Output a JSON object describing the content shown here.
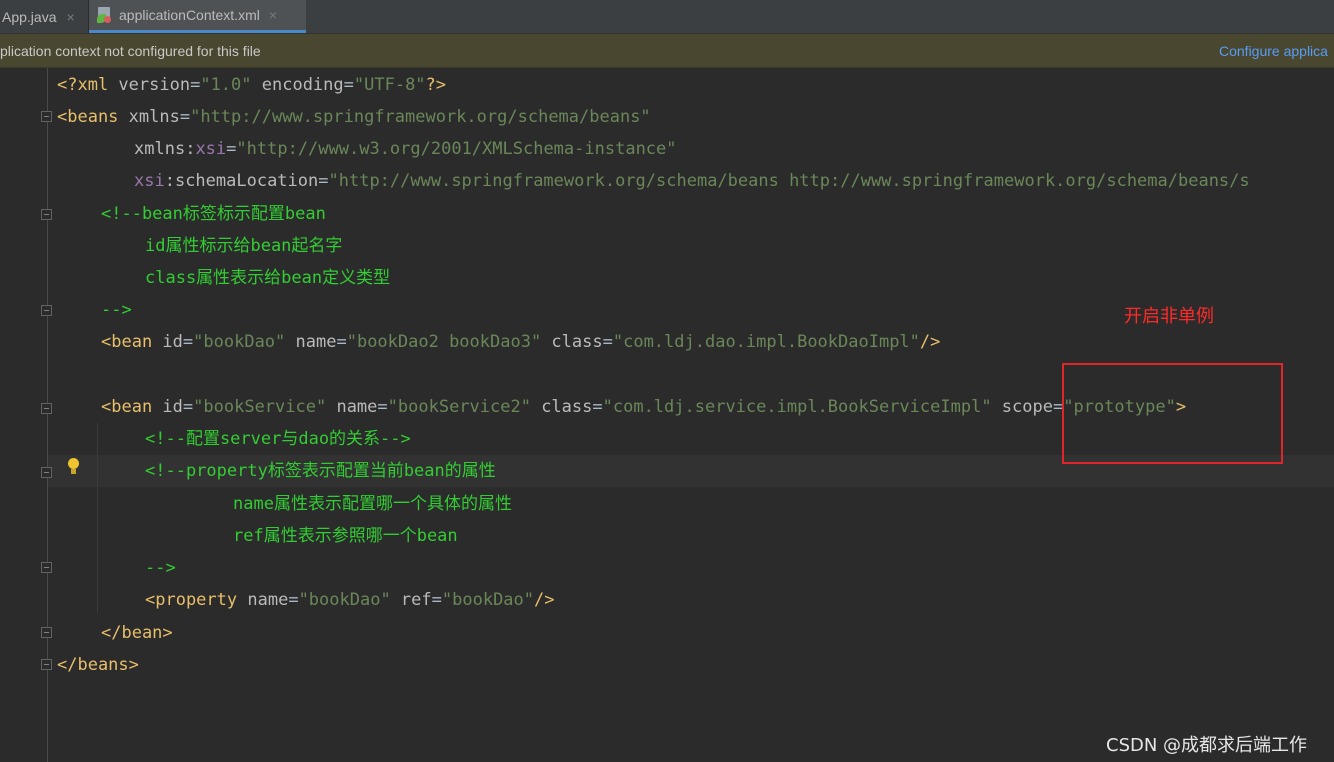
{
  "tabs": [
    {
      "label": "App.java",
      "close": "×"
    },
    {
      "label": "applicationContext.xml",
      "close": "×",
      "active": true
    }
  ],
  "banner": {
    "message": "plication context not configured for this file",
    "action": "Configure applica"
  },
  "code": {
    "l1": {
      "a": "<?xml ",
      "b": "version",
      "c": "=",
      "d": "\"1.0\"",
      "e": " encoding",
      "f": "=",
      "g": "\"UTF-8\"",
      "h": "?>"
    },
    "l2": {
      "a": "<beans ",
      "b": "xmlns",
      "c": "=",
      "d": "\"http://www.springframework.org/schema/beans\""
    },
    "l3": {
      "a": "xmlns",
      "b": ":",
      "c": "xsi",
      "d": "=",
      "e": "\"http://www.w3.org/2001/XMLSchema-instance\""
    },
    "l4": {
      "a": "xsi",
      "b": ":schemaLocation",
      "c": "=",
      "d": "\"http://www.springframework.org/schema/beans http://www.springframework.org/schema/beans/s"
    },
    "l5": "<!--bean标签标示配置bean",
    "l6": "id属性标示给bean起名字",
    "l7": "class属性表示给bean定义类型",
    "l8": "-->",
    "l9": {
      "a": "<bean ",
      "b": "id",
      "c": "=",
      "d": "\"bookDao\"",
      "e": " name",
      "f": "=",
      "g": "\"bookDao2 bookDao3\"",
      "h": " class",
      "i": "=",
      "j": "\"com.ldj.dao.impl.BookDaoImpl\"",
      "k": "/>"
    },
    "l11": {
      "a": "<bean ",
      "b": "id",
      "c": "=",
      "d": "\"bookService\"",
      "e": " name",
      "f": "=",
      "g": "\"bookService2\"",
      "h": " class",
      "i": "=",
      "j": "\"com.ldj.service.impl.BookServiceImpl\"",
      "k": " scope",
      "l": "=",
      "m": "\"prototype\"",
      "n": ">"
    },
    "l12": "<!--配置server与dao的关系-->",
    "l13": "<!--property标签表示配置当前bean的属性",
    "l14": "name属性表示配置哪一个具体的属性",
    "l15": "ref属性表示参照哪一个bean",
    "l16": "-->",
    "l17": {
      "a": "<property ",
      "b": "name",
      "c": "=",
      "d": "\"bookDao\"",
      "e": " ref",
      "f": "=",
      "g": "\"bookDao\"",
      "h": "/>"
    },
    "l18": "</bean>",
    "l19": "</beans>"
  },
  "annotation": {
    "note": "开启非单例"
  },
  "watermark": "CSDN @成都求后端工作",
  "colors": {
    "accent": "#4a88c7",
    "annotation": "#e0252b",
    "comment": "#32cd32",
    "tag": "#e8bf6a",
    "string": "#6a8759"
  }
}
